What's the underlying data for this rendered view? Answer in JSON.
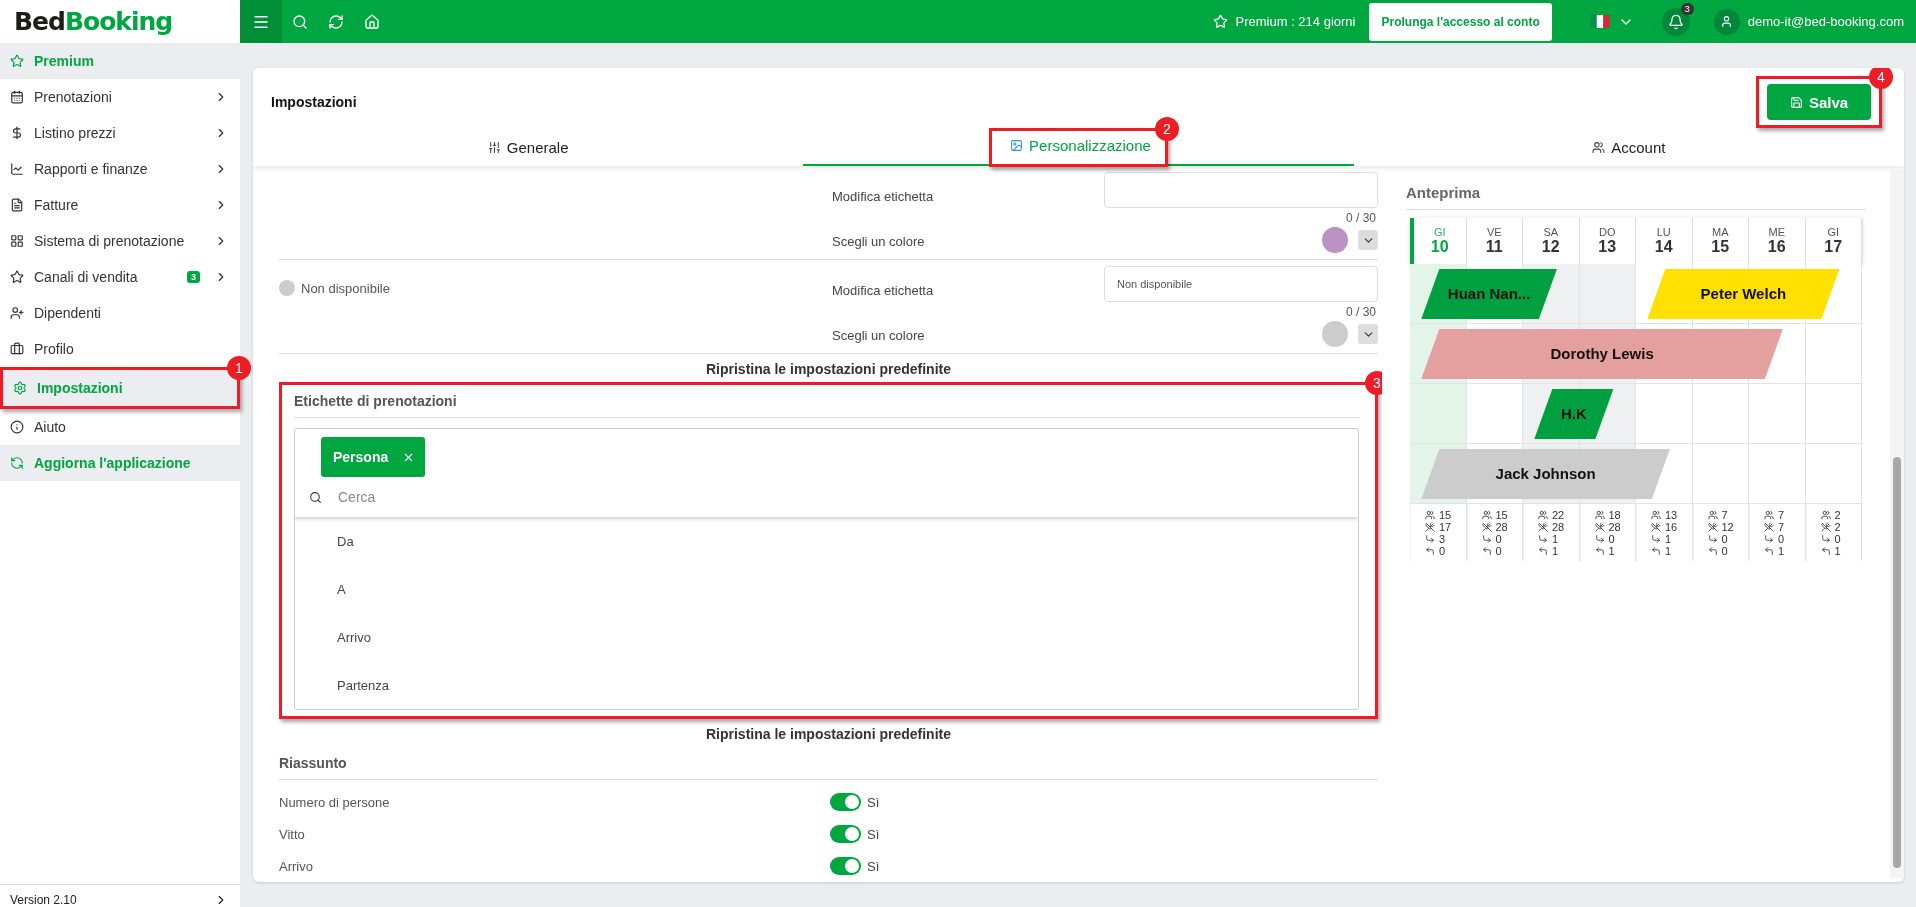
{
  "topbar": {
    "logo": {
      "part_1": "Bed",
      "part_2": "Booking"
    },
    "premium": "Premium : 214 giorni",
    "extend_button": "Prolunga l'accesso al conto",
    "notifications": "3",
    "user_email": "demo-it@bed-booking.com"
  },
  "sidebar": {
    "items": [
      {
        "label": "Premium",
        "kind": "accent",
        "selected": false,
        "chevron": false
      },
      {
        "label": "Prenotazioni",
        "kind": "link",
        "selected": false,
        "chevron": true
      },
      {
        "label": "Listino prezzi",
        "kind": "link",
        "selected": false,
        "chevron": true
      },
      {
        "label": "Rapporti e finanze",
        "kind": "link",
        "selected": false,
        "chevron": true
      },
      {
        "label": "Fatture",
        "kind": "link",
        "selected": false,
        "chevron": true
      },
      {
        "label": "Sistema di prenotazione",
        "kind": "link",
        "selected": false,
        "chevron": true
      },
      {
        "label": "Canali di vendita",
        "kind": "link",
        "selected": false,
        "chevron": true,
        "badge": "3"
      },
      {
        "label": "Dipendenti",
        "kind": "link",
        "selected": false,
        "chevron": false
      },
      {
        "label": "Profilo",
        "kind": "link",
        "selected": false,
        "chevron": false
      },
      {
        "label": "Impostazioni",
        "kind": "link",
        "selected": true,
        "chevron": false,
        "callout": "1"
      },
      {
        "label": "Aiuto",
        "kind": "link",
        "selected": false,
        "chevron": false
      },
      {
        "label": "Aggiorna l'applicazione",
        "kind": "accent",
        "selected": false,
        "chevron": false
      }
    ],
    "version": "Version 2.10"
  },
  "settings": {
    "title": "Impostazioni",
    "save_button": "Salva",
    "save_callout": "4",
    "tabs": [
      {
        "label": "Generale",
        "selected": false
      },
      {
        "label": "Personalizzazione",
        "selected": true,
        "callout": "2"
      },
      {
        "label": "Account",
        "selected": false
      }
    ]
  },
  "status_labels": {
    "groups": [
      {
        "edit_label": "Modifica etichetta",
        "counter": "0 / 30",
        "color_label": "Scegli un colore",
        "color": "#bb92c4"
      },
      {
        "name": "Non disponibile",
        "edit_label": "Modifica etichetta",
        "value": "Non disponibile",
        "counter": "0 / 30",
        "color_label": "Scegli un colore",
        "color": "#cccccc"
      }
    ],
    "reset": "Ripristina le impostazioni predefinite"
  },
  "booking_labels": {
    "title": "Etichette di prenotazioni",
    "callout": "3",
    "chips": [
      {
        "label": "Persona"
      }
    ],
    "search_placeholder": "Cerca",
    "options": [
      "Da",
      "A",
      "Arrivo",
      "Partenza"
    ],
    "reset": "Ripristina le impostazioni predefinite"
  },
  "summary": {
    "title": "Riassunto",
    "rows": [
      {
        "label": "Numero di persone",
        "on": true,
        "value": "Sì"
      },
      {
        "label": "Vitto",
        "on": true,
        "value": "Sì"
      },
      {
        "label": "Arrivo",
        "on": true,
        "value": "Sì"
      }
    ]
  },
  "preview": {
    "title": "Anteprima",
    "days": [
      {
        "weekday": "GI",
        "date": "10",
        "selected": true,
        "weekend": false,
        "stats": [
          {
            "kind": "guests",
            "value": "15"
          },
          {
            "kind": "meals",
            "value": "17"
          },
          {
            "kind": "arrivals",
            "value": "3"
          },
          {
            "kind": "departures",
            "value": "0"
          }
        ]
      },
      {
        "weekday": "VE",
        "date": "11",
        "selected": false,
        "weekend": false,
        "stats": [
          {
            "kind": "guests",
            "value": "15"
          },
          {
            "kind": "meals",
            "value": "28"
          },
          {
            "kind": "arrivals",
            "value": "0"
          },
          {
            "kind": "departures",
            "value": "0"
          }
        ]
      },
      {
        "weekday": "SA",
        "date": "12",
        "selected": false,
        "weekend": true,
        "stats": [
          {
            "kind": "guests",
            "value": "22"
          },
          {
            "kind": "meals",
            "value": "28"
          },
          {
            "kind": "arrivals",
            "value": "1"
          },
          {
            "kind": "departures",
            "value": "1"
          }
        ]
      },
      {
        "weekday": "DO",
        "date": "13",
        "selected": false,
        "weekend": true,
        "stats": [
          {
            "kind": "guests",
            "value": "18"
          },
          {
            "kind": "meals",
            "value": "28"
          },
          {
            "kind": "arrivals",
            "value": "0"
          },
          {
            "kind": "departures",
            "value": "1"
          }
        ]
      },
      {
        "weekday": "LU",
        "date": "14",
        "selected": false,
        "weekend": false,
        "stats": [
          {
            "kind": "guests",
            "value": "13"
          },
          {
            "kind": "meals",
            "value": "16"
          },
          {
            "kind": "arrivals",
            "value": "1"
          },
          {
            "kind": "departures",
            "value": "1"
          }
        ]
      },
      {
        "weekday": "MA",
        "date": "15",
        "selected": false,
        "weekend": false,
        "stats": [
          {
            "kind": "guests",
            "value": "7"
          },
          {
            "kind": "meals",
            "value": "12"
          },
          {
            "kind": "arrivals",
            "value": "0"
          },
          {
            "kind": "departures",
            "value": "0"
          }
        ]
      },
      {
        "weekday": "ME",
        "date": "16",
        "selected": false,
        "weekend": false,
        "stats": [
          {
            "kind": "guests",
            "value": "7"
          },
          {
            "kind": "meals",
            "value": "7"
          },
          {
            "kind": "arrivals",
            "value": "0"
          },
          {
            "kind": "departures",
            "value": "1"
          }
        ]
      },
      {
        "weekday": "GI",
        "date": "17",
        "selected": false,
        "weekend": false,
        "stats": [
          {
            "kind": "guests",
            "value": "2"
          },
          {
            "kind": "meals",
            "value": "2"
          },
          {
            "kind": "arrivals",
            "value": "0"
          },
          {
            "kind": "departures",
            "value": "1"
          }
        ]
      }
    ],
    "rows": [
      {
        "slots": [
          {
            "kind": "booking",
            "name": "Huan Nan...",
            "color": "#00a040"
          },
          {
            "kind": "stay"
          },
          {
            "kind": "free"
          },
          {
            "kind": "free"
          },
          {
            "kind": "booking",
            "name": "Peter Welch",
            "color": "#ffe000"
          },
          {
            "kind": "stay"
          },
          {
            "kind": "stay"
          },
          {
            "kind": "free"
          }
        ]
      },
      {
        "slots": [
          {
            "kind": "booking",
            "name": "Dorothy Lewis",
            "color": "#e4a09f"
          },
          {
            "kind": "stay"
          },
          {
            "kind": "stay"
          },
          {
            "kind": "stay"
          },
          {
            "kind": "stay"
          },
          {
            "kind": "stay"
          },
          {
            "kind": "free"
          },
          {
            "kind": "free"
          }
        ]
      },
      {
        "slots": [
          {
            "kind": "free"
          },
          {
            "kind": "free"
          },
          {
            "kind": "booking",
            "name": "H.K",
            "color": "#00a040"
          },
          {
            "kind": "free"
          },
          {
            "kind": "free"
          },
          {
            "kind": "free"
          },
          {
            "kind": "free"
          },
          {
            "kind": "free"
          }
        ]
      },
      {
        "slots": [
          {
            "kind": "booking",
            "name": "Jack Johnson",
            "color": "#cccccc"
          },
          {
            "kind": "stay"
          },
          {
            "kind": "stay"
          },
          {
            "kind": "stay"
          },
          {
            "kind": "free"
          },
          {
            "kind": "free"
          },
          {
            "kind": "free"
          },
          {
            "kind": "free"
          }
        ]
      }
    ]
  }
}
